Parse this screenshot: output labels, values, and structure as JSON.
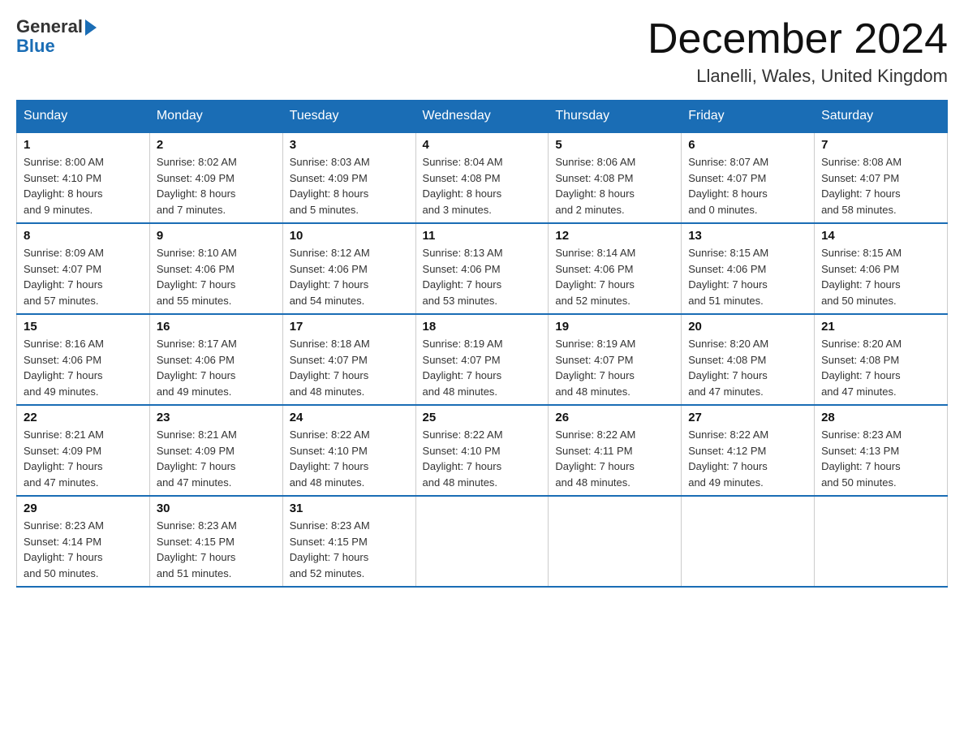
{
  "header": {
    "logo_general": "General",
    "logo_blue": "Blue",
    "month_title": "December 2024",
    "location": "Llanelli, Wales, United Kingdom"
  },
  "weekdays": [
    "Sunday",
    "Monday",
    "Tuesday",
    "Wednesday",
    "Thursday",
    "Friday",
    "Saturday"
  ],
  "weeks": [
    [
      {
        "day": "1",
        "info": "Sunrise: 8:00 AM\nSunset: 4:10 PM\nDaylight: 8 hours\nand 9 minutes."
      },
      {
        "day": "2",
        "info": "Sunrise: 8:02 AM\nSunset: 4:09 PM\nDaylight: 8 hours\nand 7 minutes."
      },
      {
        "day": "3",
        "info": "Sunrise: 8:03 AM\nSunset: 4:09 PM\nDaylight: 8 hours\nand 5 minutes."
      },
      {
        "day": "4",
        "info": "Sunrise: 8:04 AM\nSunset: 4:08 PM\nDaylight: 8 hours\nand 3 minutes."
      },
      {
        "day": "5",
        "info": "Sunrise: 8:06 AM\nSunset: 4:08 PM\nDaylight: 8 hours\nand 2 minutes."
      },
      {
        "day": "6",
        "info": "Sunrise: 8:07 AM\nSunset: 4:07 PM\nDaylight: 8 hours\nand 0 minutes."
      },
      {
        "day": "7",
        "info": "Sunrise: 8:08 AM\nSunset: 4:07 PM\nDaylight: 7 hours\nand 58 minutes."
      }
    ],
    [
      {
        "day": "8",
        "info": "Sunrise: 8:09 AM\nSunset: 4:07 PM\nDaylight: 7 hours\nand 57 minutes."
      },
      {
        "day": "9",
        "info": "Sunrise: 8:10 AM\nSunset: 4:06 PM\nDaylight: 7 hours\nand 55 minutes."
      },
      {
        "day": "10",
        "info": "Sunrise: 8:12 AM\nSunset: 4:06 PM\nDaylight: 7 hours\nand 54 minutes."
      },
      {
        "day": "11",
        "info": "Sunrise: 8:13 AM\nSunset: 4:06 PM\nDaylight: 7 hours\nand 53 minutes."
      },
      {
        "day": "12",
        "info": "Sunrise: 8:14 AM\nSunset: 4:06 PM\nDaylight: 7 hours\nand 52 minutes."
      },
      {
        "day": "13",
        "info": "Sunrise: 8:15 AM\nSunset: 4:06 PM\nDaylight: 7 hours\nand 51 minutes."
      },
      {
        "day": "14",
        "info": "Sunrise: 8:15 AM\nSunset: 4:06 PM\nDaylight: 7 hours\nand 50 minutes."
      }
    ],
    [
      {
        "day": "15",
        "info": "Sunrise: 8:16 AM\nSunset: 4:06 PM\nDaylight: 7 hours\nand 49 minutes."
      },
      {
        "day": "16",
        "info": "Sunrise: 8:17 AM\nSunset: 4:06 PM\nDaylight: 7 hours\nand 49 minutes."
      },
      {
        "day": "17",
        "info": "Sunrise: 8:18 AM\nSunset: 4:07 PM\nDaylight: 7 hours\nand 48 minutes."
      },
      {
        "day": "18",
        "info": "Sunrise: 8:19 AM\nSunset: 4:07 PM\nDaylight: 7 hours\nand 48 minutes."
      },
      {
        "day": "19",
        "info": "Sunrise: 8:19 AM\nSunset: 4:07 PM\nDaylight: 7 hours\nand 48 minutes."
      },
      {
        "day": "20",
        "info": "Sunrise: 8:20 AM\nSunset: 4:08 PM\nDaylight: 7 hours\nand 47 minutes."
      },
      {
        "day": "21",
        "info": "Sunrise: 8:20 AM\nSunset: 4:08 PM\nDaylight: 7 hours\nand 47 minutes."
      }
    ],
    [
      {
        "day": "22",
        "info": "Sunrise: 8:21 AM\nSunset: 4:09 PM\nDaylight: 7 hours\nand 47 minutes."
      },
      {
        "day": "23",
        "info": "Sunrise: 8:21 AM\nSunset: 4:09 PM\nDaylight: 7 hours\nand 47 minutes."
      },
      {
        "day": "24",
        "info": "Sunrise: 8:22 AM\nSunset: 4:10 PM\nDaylight: 7 hours\nand 48 minutes."
      },
      {
        "day": "25",
        "info": "Sunrise: 8:22 AM\nSunset: 4:10 PM\nDaylight: 7 hours\nand 48 minutes."
      },
      {
        "day": "26",
        "info": "Sunrise: 8:22 AM\nSunset: 4:11 PM\nDaylight: 7 hours\nand 48 minutes."
      },
      {
        "day": "27",
        "info": "Sunrise: 8:22 AM\nSunset: 4:12 PM\nDaylight: 7 hours\nand 49 minutes."
      },
      {
        "day": "28",
        "info": "Sunrise: 8:23 AM\nSunset: 4:13 PM\nDaylight: 7 hours\nand 50 minutes."
      }
    ],
    [
      {
        "day": "29",
        "info": "Sunrise: 8:23 AM\nSunset: 4:14 PM\nDaylight: 7 hours\nand 50 minutes."
      },
      {
        "day": "30",
        "info": "Sunrise: 8:23 AM\nSunset: 4:15 PM\nDaylight: 7 hours\nand 51 minutes."
      },
      {
        "day": "31",
        "info": "Sunrise: 8:23 AM\nSunset: 4:15 PM\nDaylight: 7 hours\nand 52 minutes."
      },
      null,
      null,
      null,
      null
    ]
  ]
}
